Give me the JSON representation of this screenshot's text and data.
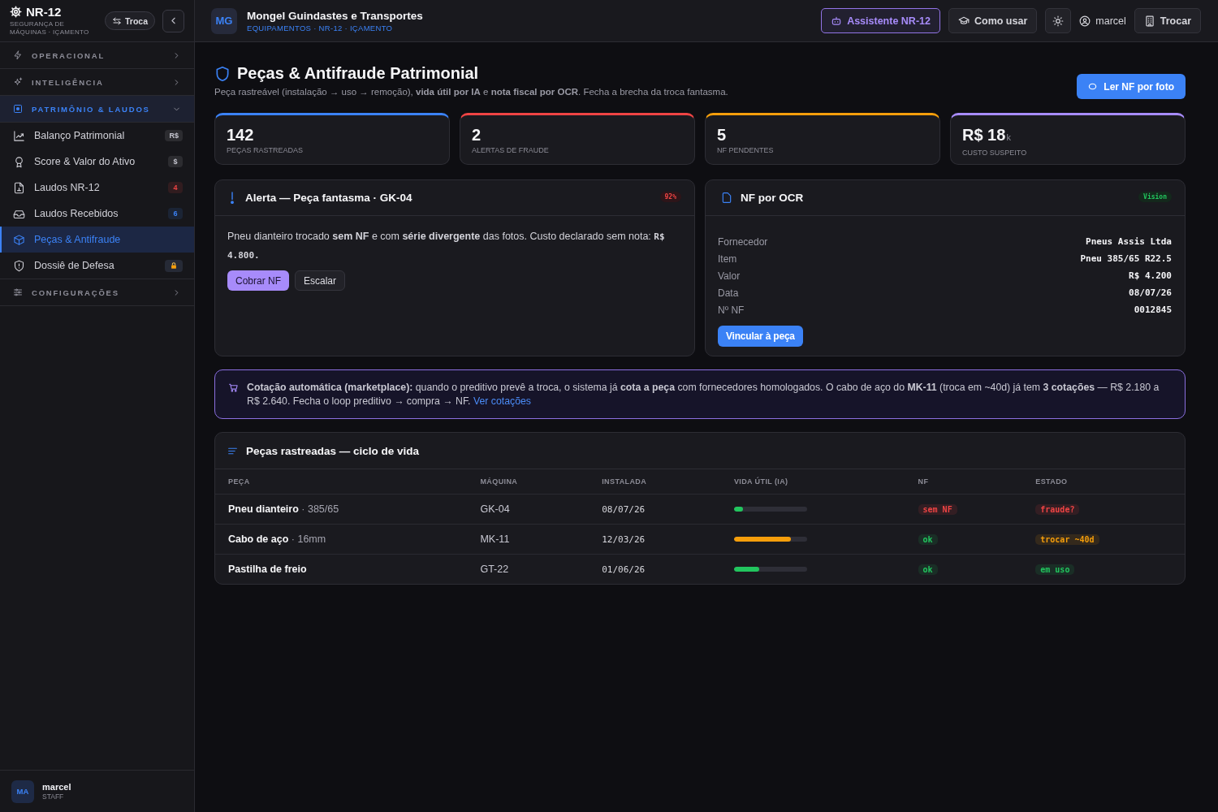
{
  "sidebar": {
    "brand": {
      "title": "NR-12",
      "subtitle": "SEGURANÇA DE MÁQUINAS · IÇAMENTO",
      "switch_button": "Troca"
    },
    "sections": [
      {
        "label": "OPERACIONAL",
        "expanded": false
      },
      {
        "label": "INTELIGÊNCIA",
        "expanded": false
      },
      {
        "label": "PATRIMÔNIO & LAUDOS",
        "expanded": true,
        "children": [
          {
            "label": "Balanço Patrimonial",
            "badge": "R$",
            "color": "#c4c4ce",
            "locked": false,
            "selected": false
          },
          {
            "label": "Score & Valor do Ativo",
            "badge": "$",
            "color": "#c4c4ce",
            "locked": false,
            "selected": false
          },
          {
            "label": "Laudos NR-12",
            "badge": "4",
            "color": "#ef4444",
            "locked": false,
            "selected": false
          },
          {
            "label": "Laudos Recebidos",
            "badge": "6",
            "color": "#3b82f6",
            "locked": false,
            "selected": false
          },
          {
            "label": "Peças & Antifraude",
            "locked": false,
            "selected": true
          },
          {
            "label": "Dossiê de Defesa",
            "locked": true,
            "selected": false
          }
        ]
      },
      {
        "label": "CONFIGURAÇÕES",
        "expanded": false
      }
    ],
    "user": {
      "initials": "MA",
      "name": "marcel",
      "role": "STAFF"
    }
  },
  "header": {
    "initials": "MG",
    "company": "Mongel Guindastes e Transportes",
    "breadcrumb": "EQUIPAMENTOS · NR-12 · IÇAMENTO",
    "assistant_button": "Assistente NR-12",
    "help_button": "Como usar",
    "user": "marcel",
    "switch_button": "Trocar"
  },
  "page": {
    "title": "Peças & Antifraude Patrimonial",
    "subtitle": "Peça rastreável (instalação → uso → remoção), **vida útil por IA** e **nota fiscal por OCR**. Fecha a brecha da troca fantasma.",
    "action_button": "Ler NF por foto"
  },
  "kpis": [
    {
      "value": "142",
      "label": "PEÇAS RASTREADAS",
      "color": "#3b82f6"
    },
    {
      "value": "2",
      "label": "ALERTAS DE FRAUDE",
      "color": "#ef4444"
    },
    {
      "value": "5",
      "label": "NF PENDENTES",
      "color": "#f59e0b"
    },
    {
      "value": "R$ 18",
      "unit": "k",
      "label": "CUSTO SUSPEITO",
      "color": "#a78bfa"
    }
  ],
  "alert": {
    "title": "Alerta — Peça fantasma · GK-04",
    "score": "92%",
    "text": "Pneu dianteiro trocado **sem NF** e com **série divergente** das fotos. Custo declarado sem nota:",
    "amount": "R$ 4.800.",
    "buttons": [
      {
        "label": "Cobrar NF",
        "kind": "primary"
      },
      {
        "label": "Escalar",
        "kind": "secondary"
      }
    ]
  },
  "ocr": {
    "title": "NF por OCR",
    "badge": "Vision",
    "fields": [
      {
        "label": "Fornecedor",
        "value": "Pneus Assis Ltda"
      },
      {
        "label": "Item",
        "value": "Pneu 385/65 R22.5"
      },
      {
        "label": "Valor",
        "value": "R$ 4.200"
      },
      {
        "label": "Data",
        "value": "08/07/26"
      },
      {
        "label": "Nº NF",
        "value": "0012845"
      }
    ],
    "button": "Vincular à peça"
  },
  "marketplace": {
    "text": "**Cotação automática (marketplace):** quando o preditivo prevê a troca, o sistema já **cota a peça** com fornecedores homologados. O cabo de aço do **MK-11** (troca em ~40d) já tem **3 cotações** — R$ 2.180 a R$ 2.640. Fecha o loop preditivo → compra → NF.",
    "link": "Ver cotações"
  },
  "table": {
    "title": "Peças rastreadas — ciclo de vida",
    "columns": [
      "PEÇA",
      "MÁQUINA",
      "INSTALADA",
      "VIDA ÚTIL (IA)",
      "NF",
      "ESTADO"
    ],
    "rows": [
      {
        "part": "Pneu dianteiro",
        "detail": "· 385/65",
        "machine": "GK-04",
        "installed": "08/07/26",
        "life": {
          "level": 0.12,
          "color": "#22c55e"
        },
        "nf": {
          "label": "sem NF",
          "color": "#ef4444"
        },
        "status": {
          "label": "fraude?",
          "color": "#ef4444"
        }
      },
      {
        "part": "Cabo de aço",
        "detail": "· 16mm",
        "machine": "MK-11",
        "installed": "12/03/26",
        "life": {
          "level": 0.78,
          "color": "#f59e0b"
        },
        "nf": {
          "label": "ok",
          "color": "#22c55e"
        },
        "status": {
          "label": "trocar ~40d",
          "color": "#f59e0b"
        }
      },
      {
        "part": "Pastilha de freio",
        "machine": "GT-22",
        "installed": "01/06/26",
        "life": {
          "level": 0.35,
          "color": "#22c55e"
        },
        "nf": {
          "label": "ok",
          "color": "#22c55e"
        },
        "status": {
          "label": "em uso",
          "color": "#22c55e"
        }
      }
    ]
  }
}
